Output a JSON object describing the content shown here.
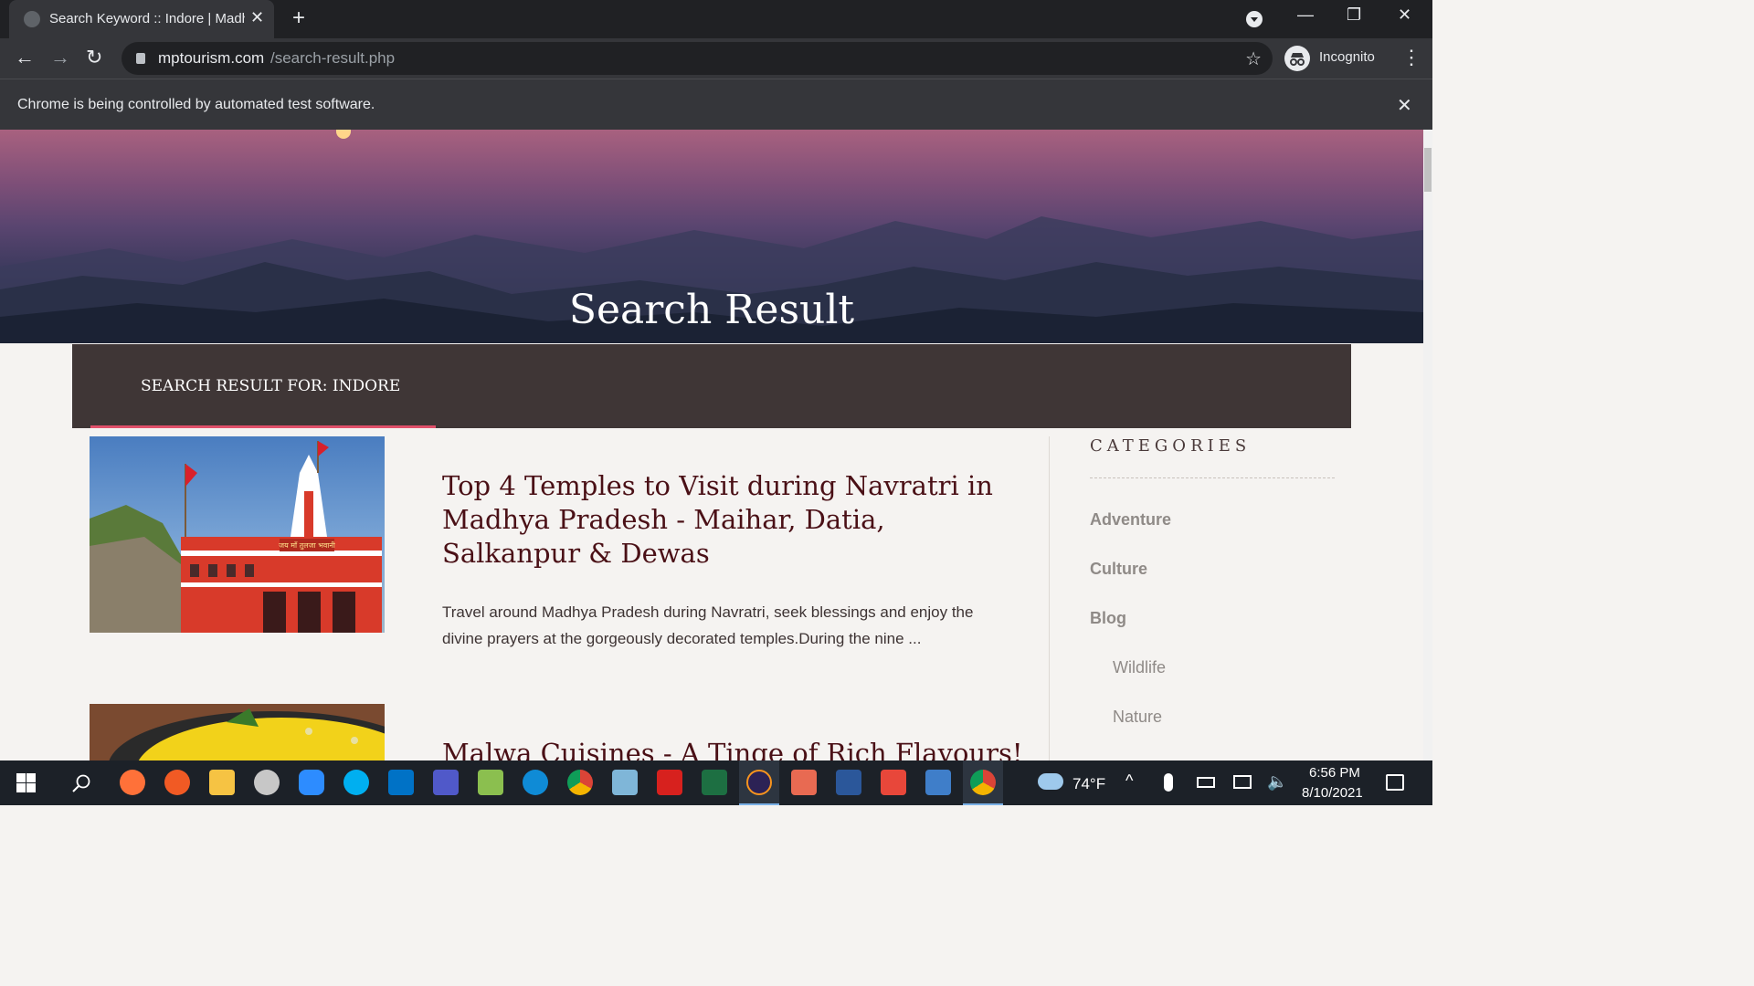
{
  "browser": {
    "tab_title": "Search Keyword :: Indore | Madhy",
    "url_host": "mptourism.com",
    "url_path": "/search-result.php",
    "profile_label": "Incognito",
    "infobar_message": "Chrome is being controlled by automated test software."
  },
  "hero": {
    "title": "Search Result"
  },
  "search_band": {
    "text": "SEARCH RESULT FOR: INDORE"
  },
  "posts": [
    {
      "title": "Top 4 Temples to Visit during Navratri in Madhya Pradesh - Maihar, Datia, Salkanpur & Dewas",
      "excerpt": "Travel around Madhya Pradesh during Navratri, seek blessings and enjoy the divine prayers at the gorgeously decorated temples.During the nine ...",
      "image_sign": "जय माँ तुलजा भवानी"
    },
    {
      "title": "Malwa Cuisines - A Tinge of Rich Flavours!"
    }
  ],
  "sidebar": {
    "heading": "CATEGORIES",
    "items": [
      "Adventure",
      "Culture",
      "Blog"
    ],
    "subitems": [
      "Wildlife",
      "Nature"
    ]
  },
  "taskbar": {
    "weather": "74°F",
    "time": "6:56 PM",
    "date": "8/10/2021",
    "apps": [
      "firefox",
      "pen-tool",
      "file-explorer",
      "paint",
      "zoom",
      "skype",
      "outlook",
      "teams",
      "notepad",
      "edge",
      "chrome",
      "editor",
      "acrobat",
      "excel",
      "eclipse",
      "box",
      "word",
      "snagit",
      "snagit-editor",
      "chrome-active"
    ]
  },
  "colors": {
    "band_bg": "#3f3636",
    "band_accent": "#e0506a",
    "post_title": "#4a1016",
    "category_text": "#8f8a87"
  }
}
